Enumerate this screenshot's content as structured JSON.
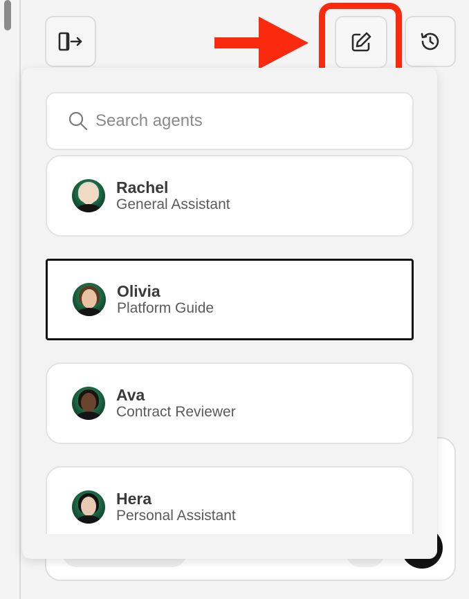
{
  "toolbar": {
    "exit_icon": "exit-panel-icon",
    "edit_icon": "edit-icon",
    "history_icon": "history-icon"
  },
  "highlight_color": "#fa2a0f",
  "search": {
    "placeholder": "Search agents"
  },
  "agents": [
    {
      "name": "Rachel",
      "role": "General Assistant",
      "selected": false,
      "hair": "#e8dcc8",
      "skin": "#f1d9c4"
    },
    {
      "name": "Olivia",
      "role": "Platform Guide",
      "selected": true,
      "hair": "#5b3a22",
      "skin": "#e8c2a2"
    },
    {
      "name": "Ava",
      "role": "Contract Reviewer",
      "selected": false,
      "hair": "#1c1410",
      "skin": "#6b4430"
    },
    {
      "name": "Hera",
      "role": "Personal Assistant",
      "selected": false,
      "hair": "#121010",
      "skin": "#e9c9b2"
    }
  ]
}
